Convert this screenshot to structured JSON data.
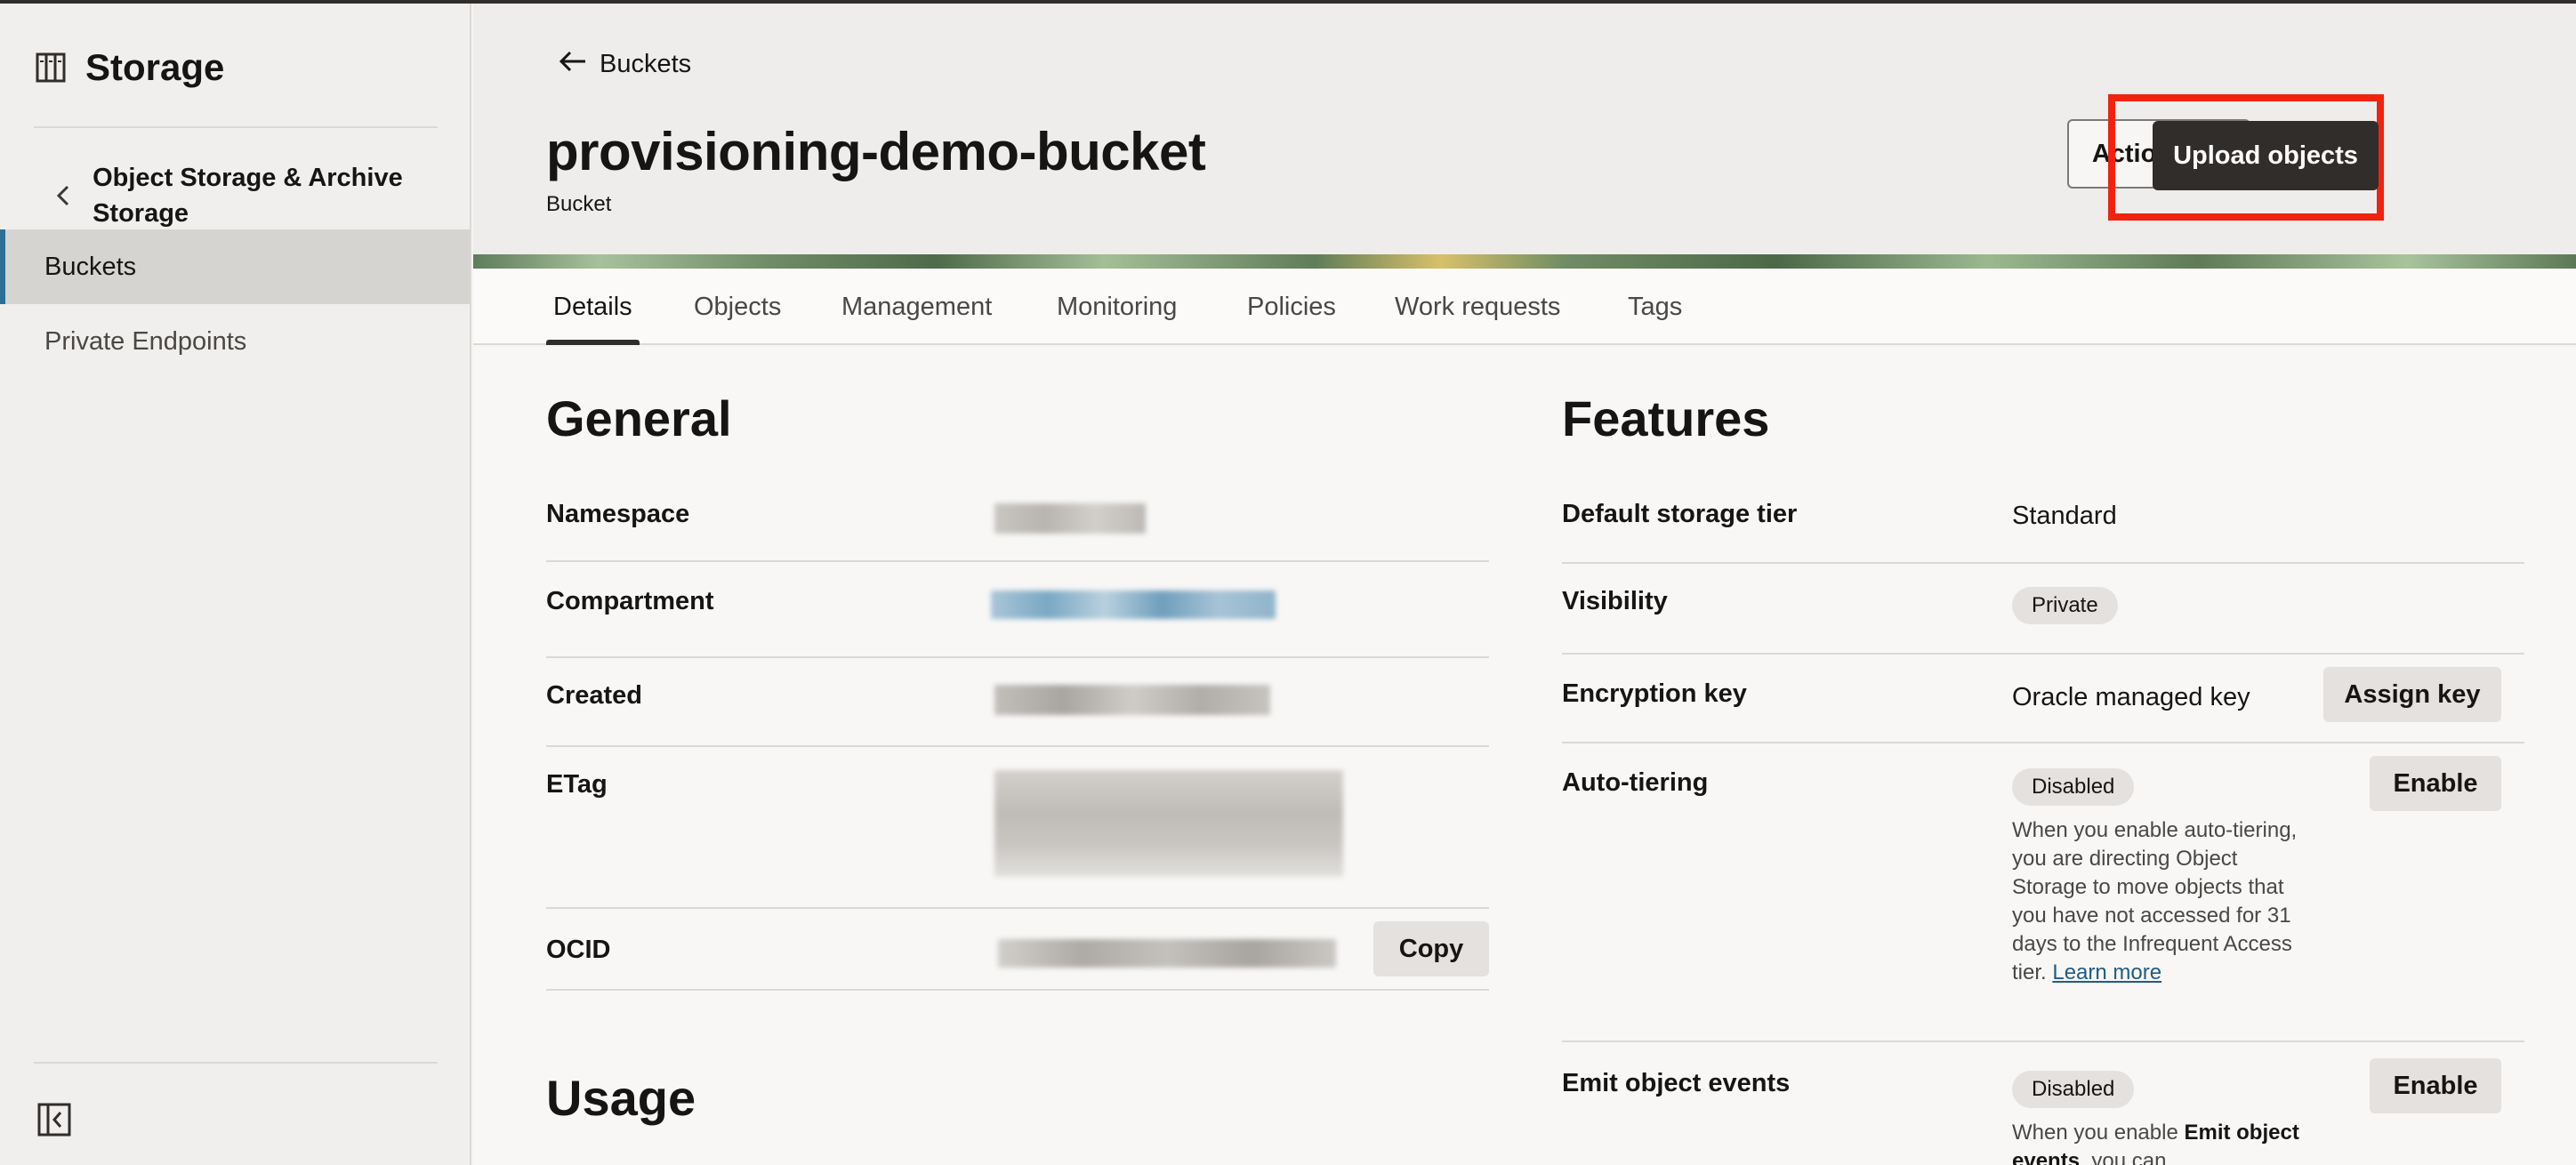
{
  "sidebar": {
    "title": "Storage",
    "back_label": "Object Storage & Archive Storage",
    "items": [
      {
        "label": "Buckets",
        "active": true
      },
      {
        "label": "Private Endpoints",
        "active": false
      }
    ]
  },
  "header": {
    "back_label": "Buckets",
    "title": "provisioning-demo-bucket",
    "subtitle": "Bucket",
    "actions_label": "Actions",
    "upload_label": "Upload objects"
  },
  "tabs": [
    {
      "label": "Details",
      "active": true
    },
    {
      "label": "Objects",
      "active": false
    },
    {
      "label": "Management",
      "active": false
    },
    {
      "label": "Monitoring",
      "active": false
    },
    {
      "label": "Policies",
      "active": false
    },
    {
      "label": "Work requests",
      "active": false
    },
    {
      "label": "Tags",
      "active": false
    }
  ],
  "general": {
    "heading": "General",
    "rows": [
      {
        "label": "Namespace"
      },
      {
        "label": "Compartment"
      },
      {
        "label": "Created"
      },
      {
        "label": "ETag"
      },
      {
        "label": "OCID"
      }
    ],
    "copy_label": "Copy"
  },
  "usage": {
    "heading": "Usage"
  },
  "features": {
    "heading": "Features",
    "storage_tier": {
      "label": "Default storage tier",
      "value": "Standard"
    },
    "visibility": {
      "label": "Visibility",
      "value": "Private"
    },
    "encryption": {
      "label": "Encryption key",
      "value": "Oracle managed key",
      "button": "Assign key"
    },
    "auto_tiering": {
      "label": "Auto-tiering",
      "status": "Disabled",
      "button": "Enable",
      "description": "When you enable auto-tiering, you are directing Object Storage to move objects that you have not accessed for 31 days to the Infrequent Access tier.",
      "link": "Learn more"
    },
    "emit_events": {
      "label": "Emit object events",
      "status": "Disabled",
      "button": "Enable",
      "desc_prefix": "When you enable",
      "desc_bold": "Emit object events",
      "desc_suffix": ", you can"
    }
  },
  "colors": {
    "primary_button": "#312d2a",
    "highlight_box": "#f0230f",
    "active_nav_accent": "#2a6f94",
    "link": "#1f5c86"
  }
}
